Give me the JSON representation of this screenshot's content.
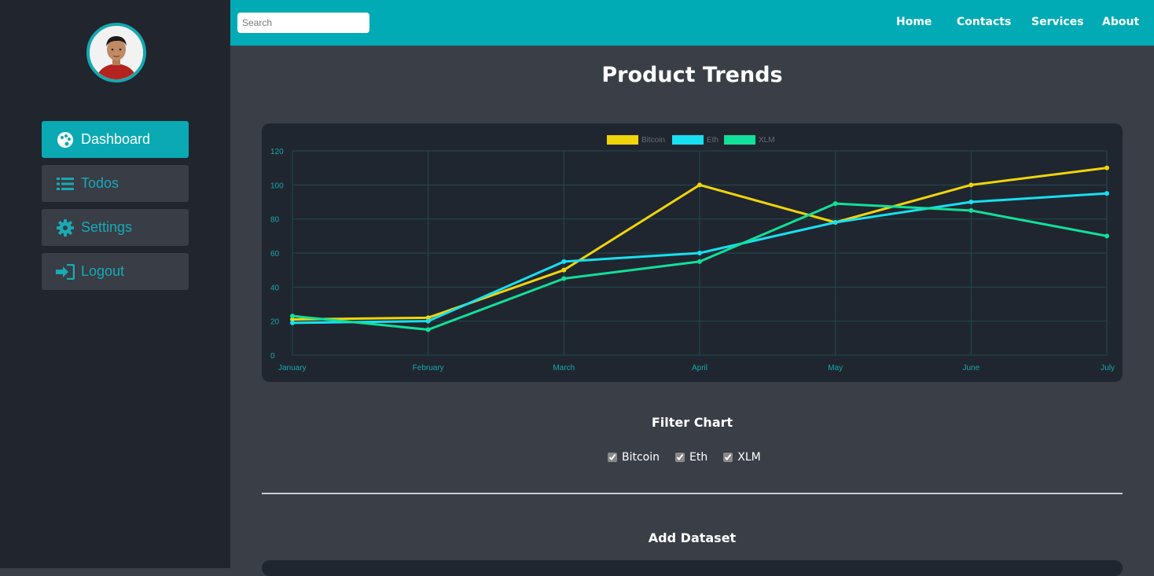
{
  "sidebar": {
    "items": [
      {
        "label": "Dashboard",
        "icon": "palette-icon",
        "active": true
      },
      {
        "label": "Todos",
        "icon": "list-icon",
        "active": false
      },
      {
        "label": "Settings",
        "icon": "gear-icon",
        "active": false
      },
      {
        "label": "Logout",
        "icon": "sign-in-icon",
        "active": false
      }
    ]
  },
  "topbar": {
    "search_placeholder": "Search",
    "links": [
      "Home",
      "Contacts",
      "Services",
      "About"
    ]
  },
  "page_title": "Product Trends",
  "filter": {
    "title": "Filter Chart",
    "options": [
      {
        "label": "Bitcoin",
        "checked": true
      },
      {
        "label": "Eth",
        "checked": true
      },
      {
        "label": "XLM",
        "checked": true
      }
    ]
  },
  "add_dataset": {
    "title": "Add Dataset"
  },
  "colors": {
    "accent": "#00abb5",
    "sidebar_bg": "#20252e",
    "main_bg": "#3a3e47",
    "chart_bg": "#20262f",
    "grid": "#1f4a50",
    "tick": "#14a9b1"
  },
  "chart_data": {
    "type": "line",
    "categories": [
      "January",
      "February",
      "March",
      "April",
      "May",
      "June",
      "July"
    ],
    "ylim": [
      0,
      120
    ],
    "yticks": [
      0,
      20,
      40,
      60,
      80,
      100,
      120
    ],
    "grid": true,
    "legend_position": "top-center",
    "series": [
      {
        "name": "Bitcoin",
        "color": "#f0d50a",
        "values": [
          21,
          22,
          50,
          100,
          78,
          100,
          110
        ]
      },
      {
        "name": "Eth",
        "color": "#16e0f2",
        "values": [
          19,
          20,
          55,
          60,
          78,
          90,
          95
        ]
      },
      {
        "name": "XLM",
        "color": "#12e09a",
        "values": [
          23,
          15,
          45,
          55,
          89,
          85,
          70
        ]
      }
    ]
  }
}
